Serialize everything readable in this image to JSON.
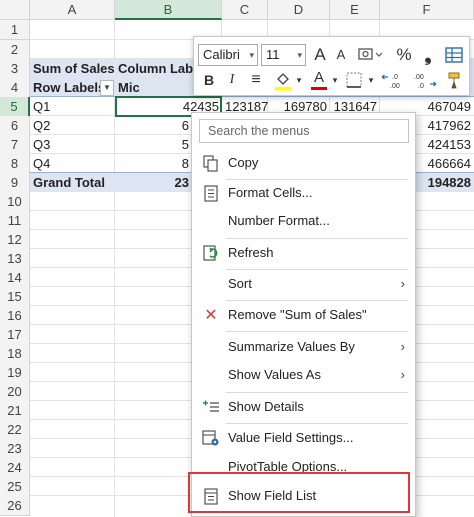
{
  "columns": [
    "A",
    "B",
    "C",
    "D",
    "E",
    "F"
  ],
  "rows": [
    "1",
    "2",
    "3",
    "4",
    "5",
    "6",
    "7",
    "8",
    "9",
    "10",
    "11",
    "12",
    "13",
    "14",
    "15",
    "16",
    "17",
    "18",
    "19",
    "20",
    "21",
    "22",
    "23",
    "24",
    "25",
    "26"
  ],
  "pivot": {
    "sum_label": "Sum of Sales",
    "column_labels": "Column Lab",
    "row_labels": "Row Labels",
    "filter_glyph": "▼",
    "mic": "Mic",
    "q1": "Q1",
    "q2": "Q2",
    "q3": "Q3",
    "q4": "Q4",
    "grand_total": "Grand Total",
    "q1_b": "42435",
    "q1_c": "123187",
    "q1_d": "169780",
    "q1_e": "131647",
    "q1_f": "467049",
    "q2_b": "6",
    "q2_f": "417962",
    "q3_b": "5",
    "q3_f": "424153",
    "q4_b": "8",
    "q4_f": "466664",
    "gt_b": "23",
    "gt_f": "194828"
  },
  "mini_toolbar": {
    "font_name": "Calibri",
    "font_size": "11",
    "increase_font": "A",
    "decrease_font": "A",
    "percent": "%",
    "comma": "❟",
    "bold": "B",
    "italic": "I",
    "align": "≡",
    "font_color_letter": "A",
    "fill_color": "#ffff00",
    "font_color": "#e00000",
    "dropdown_glyph": "▾",
    "increase_decimal": "←.0 .00",
    "decrease_decimal": ".00 →.0"
  },
  "context_menu": {
    "search_placeholder": "Search the menus",
    "copy": "Copy",
    "format_cells": "Format Cells...",
    "number_format": "Number Format...",
    "refresh": "Refresh",
    "sort": "Sort",
    "remove": "Remove \"Sum of Sales\"",
    "summarize": "Summarize Values By",
    "show_values_as": "Show Values As",
    "show_details": "Show Details",
    "value_field_settings": "Value Field Settings...",
    "pivot_options": "PivotTable Options...",
    "show_field_list": "Show Field List",
    "submenu_arrow": "›",
    "remove_icon_glyph": "✕",
    "highlight_color": "#e0353b"
  }
}
